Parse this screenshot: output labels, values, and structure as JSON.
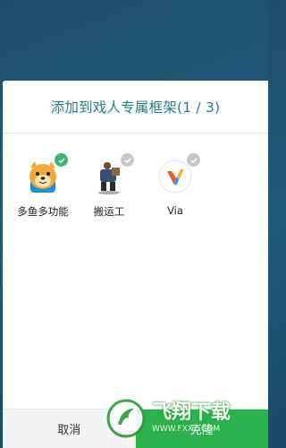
{
  "dialog": {
    "title": "添加到戏人专属框架(1 / 3)",
    "apps": [
      {
        "label": "多鱼多功能",
        "icon": "doge-cartoon-icon",
        "checked": true
      },
      {
        "label": "搬运工",
        "icon": "porter-figure-icon",
        "checked": false
      },
      {
        "label": "Via",
        "icon": "via-browser-icon",
        "checked": false
      }
    ],
    "cancel_label": "取消",
    "clone_label": "克隆"
  },
  "watermark": {
    "title": "飞翔下载",
    "url": "WWW.FXXZ.COM"
  },
  "colors": {
    "title": "#1e7f8c",
    "check_active": "#3cb371",
    "check_inactive": "#c8c8c8",
    "clone_button": "#2bb24c",
    "background": "#1f5a78"
  }
}
